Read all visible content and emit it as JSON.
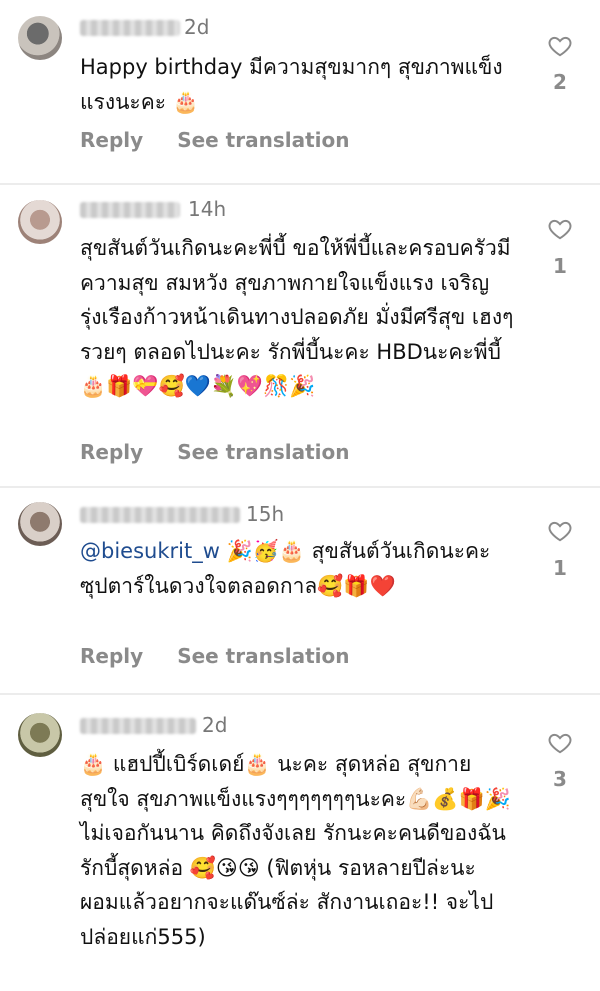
{
  "comments": [
    {
      "time": "2d",
      "text": "Happy birthday มีความสุขมากๆ สุขภาพแข็งแรงนะคะ 🎂",
      "reply_label": "Reply",
      "translate_label": "See translation",
      "likes": "2",
      "icons": [
        "avatar",
        "heart-outline-icon",
        "birthday-cake-emoji"
      ]
    },
    {
      "time": "14h",
      "text": "สุขสันต์วันเกิดนะคะพี่บี้ ขอให้พี่บี้และครอบครัวมีความสุข สมหวัง สุขภาพกายใจแข็งแรง เจริญรุ่งเรืองก้าวหน้าเดินทางปลอดภัย มั่งมีศรีสุข เฮงๆ รวยๆ ตลอดไปนะคะ รักพี่บี้นะคะ HBDนะคะพี่บี้🎂🎁💝🥰💙💐💖🎊🎉",
      "reply_label": "Reply",
      "translate_label": "See translation",
      "likes": "1",
      "icons": [
        "avatar",
        "heart-outline-icon"
      ]
    },
    {
      "time": "15h",
      "mention": "@biesukrit_w",
      "text": "🎉🥳🎂 สุขสันต์วันเกิดนะคะ ซุปตาร์ในดวงใจตลอดกาล🥰🎁❤️",
      "reply_label": "Reply",
      "translate_label": "See translation",
      "likes": "1",
      "icons": [
        "avatar",
        "heart-outline-icon"
      ]
    },
    {
      "time": "2d",
      "text": "🎂 แฮปปี้เบิร์ดเดย์🎂 นะคะ สุดหล่อ สุขกายสุขใจ สุขภาพแข็งแรงๆๆๆๆๆๆๆนะคะ💪🏻💰🎁🎉 ไม่เจอกันนาน คิดถึงจังเลย รักนะคะคนดีของฉัน รักบี้สุดหล่อ 🥰😘😘 (ฟิตหุ่น รอหลายปีล่ะนะ ผอมแล้วอยากจะแด๊นซ์ล่ะ สักงานเถอะ!! จะไปปล่อยแก่555)",
      "likes": "3",
      "icons": [
        "avatar",
        "heart-outline-icon"
      ]
    }
  ],
  "colors": {
    "mention": "#1f4c8f",
    "secondary_text": "#8a8a8a"
  }
}
